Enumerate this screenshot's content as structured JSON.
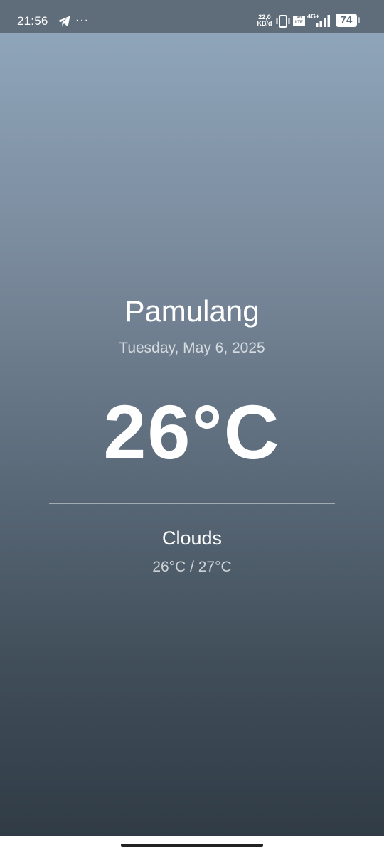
{
  "status_bar": {
    "time": "21:56",
    "more": "···",
    "net_speed_value": "22,0",
    "net_speed_unit": "KB/d",
    "volte_top": "Vo",
    "volte_bottom": "LTE",
    "net_type": "4G+",
    "battery": "74",
    "icons": [
      "telegram-icon",
      "more-icon",
      "vibrate-icon",
      "volte-icon",
      "signal-icon",
      "battery-icon"
    ]
  },
  "weather": {
    "city": "Pamulang",
    "date": "Tuesday, May 6, 2025",
    "temperature": "26°C",
    "condition": "Clouds",
    "min_max": "26°C / 27°C"
  },
  "colors": {
    "gradient_top": "#8fa5ba",
    "gradient_bottom": "#303b45",
    "status_bar": "#5f6d7a"
  }
}
